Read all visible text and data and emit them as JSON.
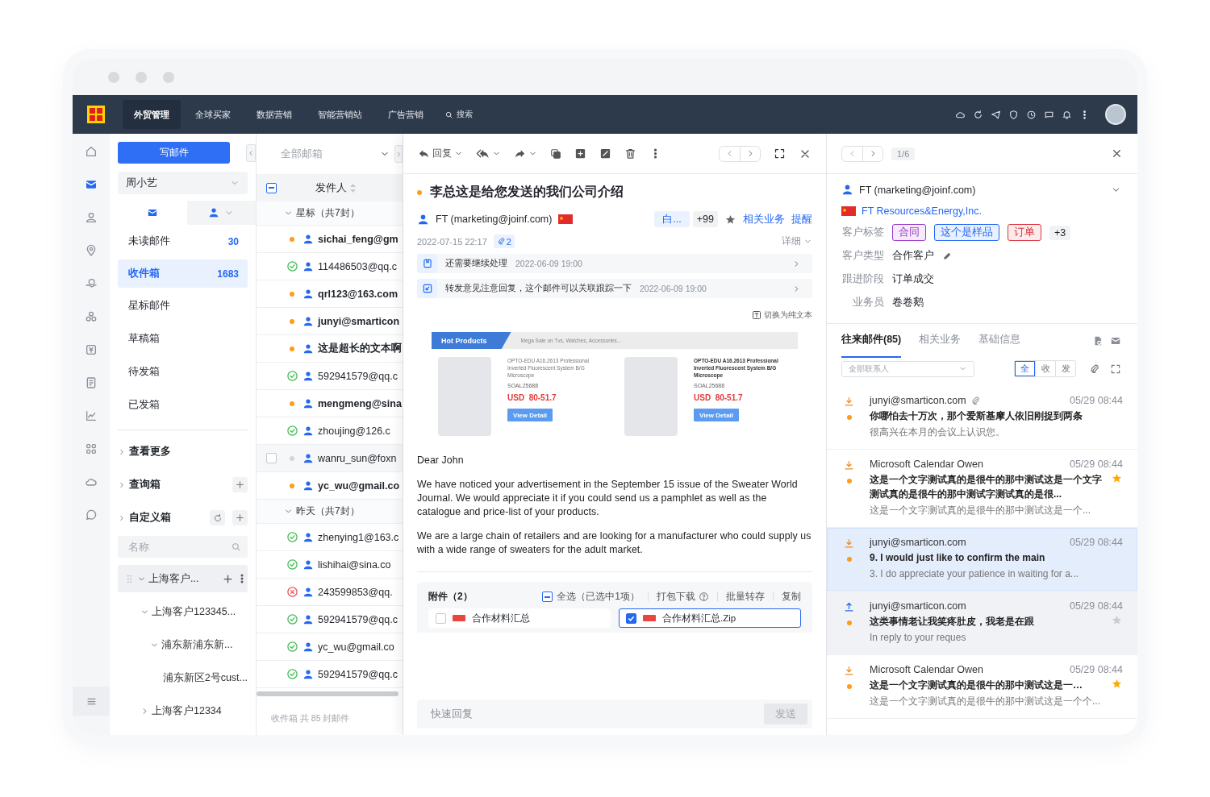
{
  "top_nav": {
    "tabs": [
      {
        "label": "外贸管理",
        "selected": true
      },
      {
        "label": "全球买家",
        "selected": false
      },
      {
        "label": "数据营销",
        "selected": false
      },
      {
        "label": "智能营销站",
        "selected": false
      },
      {
        "label": "广告营销",
        "selected": false
      }
    ],
    "search": {
      "label": "搜索"
    }
  },
  "rail": {
    "items": [
      {
        "selected": false
      },
      {
        "selected": true
      },
      {
        "selected": false
      },
      {
        "selected": false
      },
      {
        "selected": false
      },
      {
        "selected": false
      },
      {
        "selected": false
      },
      {
        "selected": false
      },
      {
        "selected": false
      },
      {
        "selected": false
      },
      {
        "selected": false
      },
      {
        "selected": false
      }
    ]
  },
  "folders": {
    "compose": "写邮件",
    "account": "周小艺",
    "view_tabs": [
      {
        "selected": true
      },
      {
        "selected": false
      }
    ],
    "items": [
      {
        "label": "未读邮件",
        "count": "30",
        "selected": false
      },
      {
        "label": "收件箱",
        "count": "1683",
        "selected": true
      },
      {
        "label": "星标邮件",
        "selected": false
      },
      {
        "label": "草稿箱",
        "selected": false
      },
      {
        "label": "待发箱",
        "selected": false
      },
      {
        "label": "已发箱",
        "selected": false
      }
    ],
    "sections": [
      {
        "label": "查看更多",
        "expanded": false,
        "kind": "plain"
      },
      {
        "label": "查询箱",
        "expanded": false,
        "kind": "add"
      },
      {
        "label": "自定义箱",
        "expanded": false,
        "kind": "refresh-add"
      }
    ],
    "search": {
      "placeholder": "名称"
    },
    "tree": [
      {
        "label": "上海客户...",
        "expanded": true,
        "selected": true,
        "children": [
          {
            "label": "上海客户123345...",
            "expanded": true,
            "children": [
              {
                "label": "浦东新浦东新...",
                "expanded": true,
                "children": [
                  {
                    "label": "浦东新区2号cust..."
                  }
                ]
              }
            ]
          },
          {
            "label": "上海客户12334",
            "expanded": false
          }
        ]
      }
    ]
  },
  "mail_list": {
    "mailbox": "全部邮箱",
    "header": {
      "label": "发件人",
      "indeterminate": true
    },
    "groups": [
      {
        "label": "星标（共7封）",
        "expanded": true,
        "rows": [
          {
            "sender": "sichai_feng@gm",
            "kind": "unread",
            "hovered": false
          },
          {
            "sender": "114486503@qq.c",
            "kind": "replied",
            "hovered": false
          },
          {
            "sender": "qrl123@163.com",
            "kind": "unread",
            "hovered": false
          },
          {
            "sender": "junyi@smarticon",
            "kind": "unread",
            "hovered": false
          },
          {
            "sender": "这是超长的文本啊",
            "kind": "unread",
            "hovered": false
          },
          {
            "sender": "592941579@qq.c",
            "kind": "replied",
            "hovered": false
          },
          {
            "sender": "mengmeng@sina",
            "kind": "unread",
            "hovered": false
          },
          {
            "sender": "zhoujing@126.c",
            "kind": "replied",
            "hovered": false
          },
          {
            "sender": "wanru_sun@foxn",
            "kind": "read",
            "hovered": true
          },
          {
            "sender": "yc_wu@gmail.co",
            "kind": "unread",
            "hovered": false
          }
        ]
      },
      {
        "label": "昨天（共7封）",
        "expanded": true,
        "rows": [
          {
            "sender": "zhenying1@163.c",
            "kind": "replied",
            "hovered": false
          },
          {
            "sender": "lishihai@sina.co",
            "kind": "replied",
            "hovered": false
          },
          {
            "sender": "243599853@qq.",
            "kind": "failed",
            "hovered": false
          },
          {
            "sender": "592941579@qq.c",
            "kind": "replied",
            "hovered": false
          },
          {
            "sender": "yc_wu@gmail.co",
            "kind": "replied",
            "hovered": false
          },
          {
            "sender": "592941579@qq.c",
            "kind": "replied",
            "hovered": false
          }
        ]
      }
    ],
    "footer": "收件箱 共 85 封邮件"
  },
  "reader": {
    "toolbar": {
      "reply": "回复"
    },
    "subject": "李总这是给您发送的我们公司介绍",
    "unread": true,
    "sender": "FT (marketing@joinf.com)",
    "tag": "白...",
    "tag_more": "+99",
    "starred": false,
    "links": [
      "相关业务",
      "提醒"
    ],
    "date": "2022-07-15 22:17",
    "attachment_count": "2",
    "details": "详细",
    "notices": [
      {
        "text": "还需要继续处理",
        "time": "2022-06-09 19:00"
      },
      {
        "text": "转发意见注意回复，这个邮件可以关联跟踪一下",
        "time": "2022-06-09 19:00"
      }
    ],
    "plain_text_toggle": "切换为纯文本",
    "promo": {
      "title": "Hot Products",
      "subtitle": "Mega Sale on Tvs, Watches, Accessories...",
      "products": [
        {
          "name": "OPTO-EDU A16.2613 Professional Inverted Fluorescent System B/G Microscope",
          "sku": "SOAL25688",
          "price": "USD  80-51.7",
          "button": "View Detail"
        },
        {
          "name": "OPTO-EDU A16.2613 Professional Inverted Fluorescent System B/G Microscope",
          "sku": "SOAL25688",
          "price": "USD  80-51.7",
          "button": "View Detail"
        }
      ]
    },
    "body": [
      "Dear John",
      "We have noticed your advertisement in the September 15 issue of the Sweater World Journal. We would appreciate it if you could send us a pamphlet as well as the catalogue and price-list of your products.",
      "We are a large chain of retailers and are looking for a manufacturer who could supply us with a wide range of sweaters for the adult market."
    ],
    "attachments": {
      "title": "附件（2）",
      "select_all": "全选（已选中1项）",
      "indeterminate": true,
      "actions": [
        "打包下载",
        "批量转存",
        "复制"
      ],
      "files": [
        {
          "name": "合作材料汇总",
          "checked": false
        },
        {
          "name": "合作材料汇总.Zip",
          "checked": true
        }
      ]
    },
    "quick_reply": {
      "placeholder": "快速回复",
      "send": "发送"
    }
  },
  "contact_panel": {
    "pager": "1/6",
    "name": "FT (marketing@joinf.com)",
    "company": "FT Resources&Energy,Inc.",
    "fields": [
      {
        "label": "客户标签",
        "kind": "tags",
        "tags": [
          {
            "text": "合同",
            "color": "#9a3cc8"
          },
          {
            "text": "这个是样品",
            "color": "#2468f2"
          },
          {
            "text": "订单",
            "color": "#d9363e"
          }
        ],
        "more": "+3"
      },
      {
        "label": "客户类型",
        "kind": "editable",
        "value": "合作客户"
      },
      {
        "label": "跟进阶段",
        "kind": "text",
        "value": "订单成交"
      },
      {
        "label": "业务员",
        "kind": "text",
        "value": "卷卷鹅"
      }
    ],
    "tabs": [
      {
        "label": "往来邮件(85)",
        "selected": true
      },
      {
        "label": "相关业务",
        "selected": false
      },
      {
        "label": "基础信息",
        "selected": false
      }
    ],
    "filter": {
      "placeholder": "全部联系人"
    },
    "segments": [
      {
        "label": "全",
        "selected": true
      },
      {
        "label": "收",
        "selected": false
      },
      {
        "label": "发",
        "selected": false
      }
    ],
    "mails": [
      {
        "kind": "received",
        "sender": "junyi@smarticon.com",
        "attachment": true,
        "time": "05/29 08:44",
        "subject": "你哪怕去十万次，那个爱斯基摩人依旧刚捉到两条",
        "preview": "很高兴在本月的会议上认识您。",
        "unread": true,
        "selected": false
      },
      {
        "kind": "received",
        "sender": "Microsoft  Calendar Owen",
        "time": "05/29 08:44",
        "subject": "这是一个文字测试真的是很牛的那中测试这是一个文字测试真的是很牛的那中测试字测试真的是很...",
        "preview": "这是一个文字测试真的是很牛的那中测试这是一个...",
        "unread": true,
        "starred": true,
        "selected": false
      },
      {
        "kind": "received",
        "sender": "junyi@smarticon.com",
        "time": "05/29 08:44",
        "subject": "9. I would just like to confirm the main",
        "preview": "3. I do appreciate your patience in waiting for a...",
        "unread": true,
        "selected": true
      },
      {
        "kind": "sent",
        "sender": "junyi@smarticon.com",
        "time": "05/29 08:44",
        "subject": "这类事情老让我笑疼肚皮，我老是在跟",
        "preview": "In reply to your reques",
        "unread": true,
        "starred": false,
        "selected": false,
        "hovered": true
      },
      {
        "kind": "received",
        "sender": "Microsoft  Calendar Owen",
        "time": "05/29 08:44",
        "subject": "这是一个文字测试真的是很牛的那中测试这是一…",
        "preview": "这是一个文字测试真的是很牛的那中测试这是一个个...",
        "unread": true,
        "starred": true,
        "selected": false
      }
    ]
  }
}
